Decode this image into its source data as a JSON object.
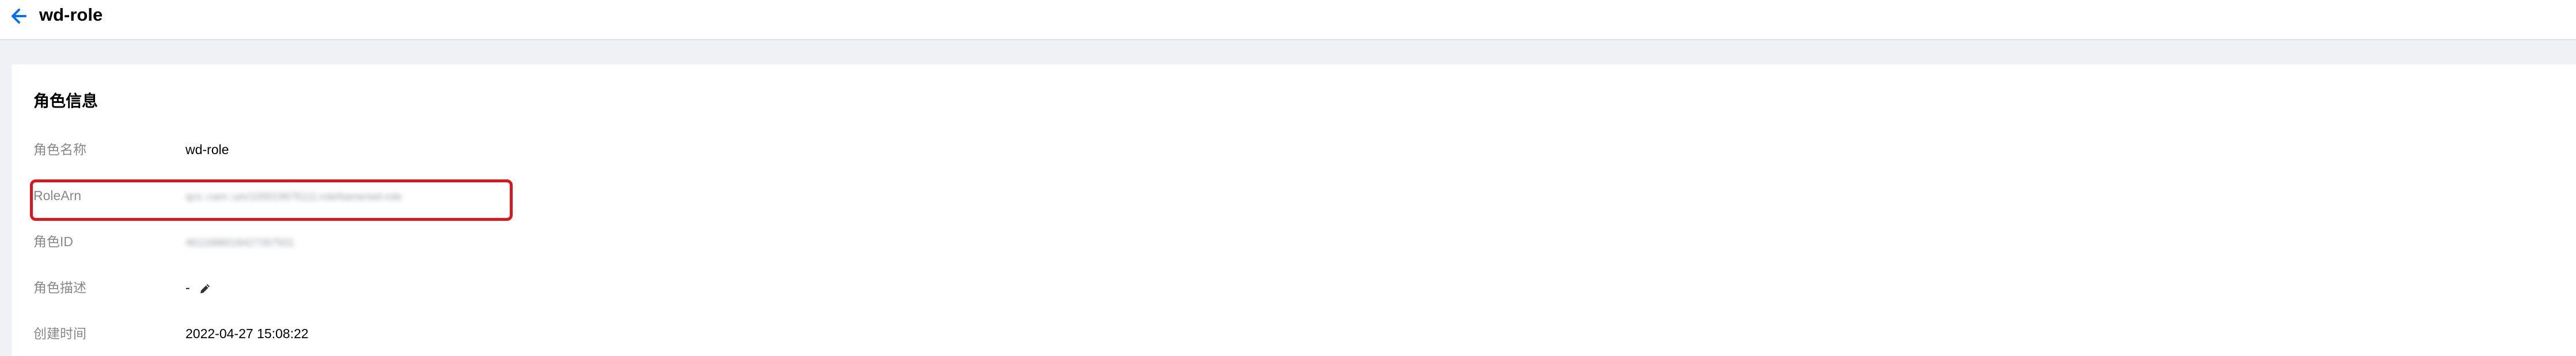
{
  "header": {
    "title": "wd-role",
    "back_icon": "arrow-left-icon"
  },
  "colors": {
    "accent": "#006eff",
    "highlight": "#e0141c",
    "label": "#888888",
    "page_background": "#f0f1f5"
  },
  "role_info": {
    "section_title": "角色信息",
    "rows": [
      {
        "label": "角色名称",
        "value": "wd-role"
      },
      {
        "label": "RoleArn",
        "value": "qcs::cam::uin/100019976111:roleName/wd-role"
      },
      {
        "label": "角色ID",
        "value": "4611686018427397931"
      },
      {
        "label": "角色描述",
        "value": "-",
        "edit_icon": "pencil-icon"
      },
      {
        "label": "创建时间",
        "value": "2022-04-27 15:08:22"
      }
    ]
  }
}
